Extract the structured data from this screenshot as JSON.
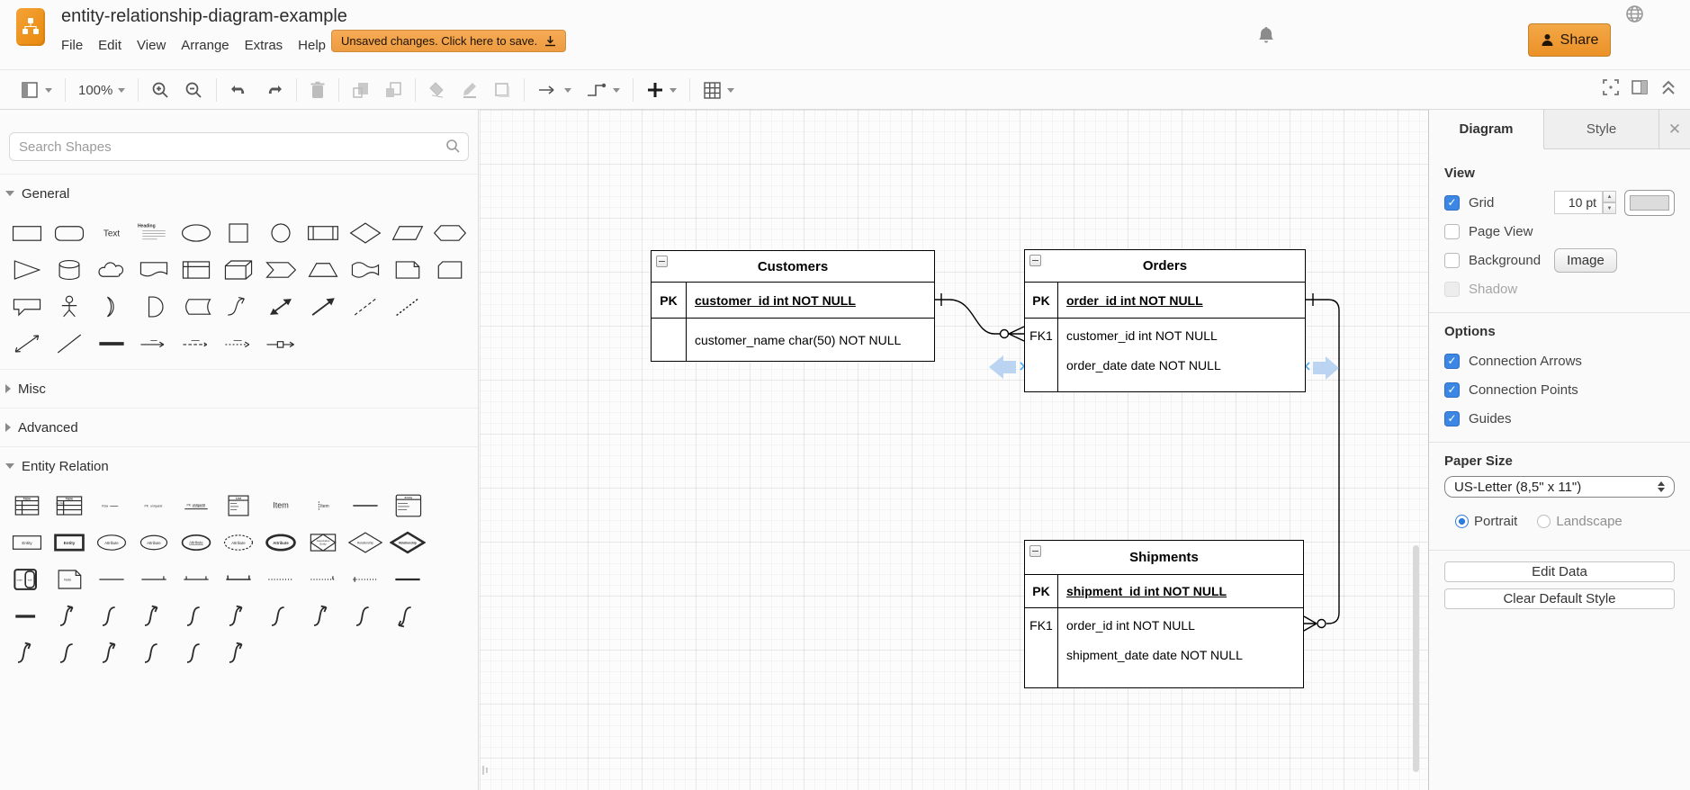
{
  "header": {
    "title": "entity-relationship-diagram-example",
    "menus": [
      "File",
      "Edit",
      "View",
      "Arrange",
      "Extras",
      "Help"
    ],
    "unsaved_banner": "Unsaved changes. Click here to save.",
    "share_label": "Share"
  },
  "toolbar": {
    "zoom_level": "100%"
  },
  "sidebar": {
    "search_placeholder": "Search Shapes",
    "sections": {
      "general": "General",
      "misc": "Misc",
      "advanced": "Advanced",
      "entity_relation": "Entity Relation"
    },
    "palettes": {
      "general": [
        [
          "rectangle",
          "rounded-rectangle",
          {
            "n": "text",
            "l": "Text"
          },
          {
            "n": "textbox",
            "l": "Heading"
          },
          "ellipse",
          "square",
          "circle",
          "process",
          "diamond",
          "parallelogram",
          "hexagon"
        ],
        [
          "triangle",
          "cylinder",
          "cloud",
          "document",
          "internal-storage",
          "cube",
          "step",
          "trapezoid",
          "tape",
          "note",
          "card"
        ],
        [
          "callout",
          "actor",
          "or",
          "and",
          "data-storage",
          "curve",
          "bidirectional-arrow",
          "arrow",
          "dashed-line",
          "dotted-line"
        ],
        [
          "bidirectional-connector",
          "line",
          "bold-line",
          "link-edge",
          "dashed-edge",
          "dashed-edge-2",
          "connector-symbol"
        ]
      ],
      "entity_relation": [
        [
          {
            "n": "table",
            "l": "Table"
          },
          {
            "n": "table-pk",
            "l": "Table"
          },
          "row",
          {
            "n": "row-pk",
            "l": "PK"
          },
          {
            "n": "row-pk-underlined",
            "l": "PK"
          },
          {
            "n": "list",
            "l": "List"
          },
          {
            "n": "item-large",
            "l": "Item"
          },
          {
            "n": "item",
            "l": "Item"
          },
          "hline",
          {
            "n": "entity-attributes",
            "l": "Entity"
          }
        ],
        [
          {
            "n": "entity",
            "l": "Entity"
          },
          {
            "n": "entity-bold",
            "l": "Entity"
          },
          {
            "n": "attribute",
            "l": "Attribute"
          },
          {
            "n": "attribute-2",
            "l": "Attribute"
          },
          {
            "n": "attribute-underlined",
            "l": "Attribute"
          },
          {
            "n": "attribute-dashed",
            "l": "Attribute"
          },
          {
            "n": "attribute-bold",
            "l": "Attribute"
          },
          {
            "n": "associative-entity",
            "l": "Entity"
          },
          {
            "n": "relationship",
            "l": "Relationship"
          },
          {
            "n": "relationship-bold",
            "l": "Relationship"
          }
        ],
        [
          "composite",
          {
            "n": "note-er",
            "l": "Note"
          },
          "link",
          "link-tick",
          "link-tick-2",
          "link-bracket",
          "link-dotted",
          "link-dotted-2",
          "link-dotted-3",
          "link-bold"
        ],
        [
          "edge-bold",
          "scurve-arrow",
          "scurve",
          "scurve-arrow",
          "scurve",
          "scurve-arrow",
          "scurve",
          "scurve-arrow",
          "scurve",
          "scurve-arrow-down"
        ],
        [
          "scurve-arrow",
          "scurve",
          "scurve-arrow",
          "scurve",
          "scurve",
          "scurve-arrow"
        ]
      ]
    }
  },
  "canvas": {
    "entities": [
      {
        "title": "Customers",
        "rows": [
          {
            "key": "PK",
            "text": "customer_id int NOT NULL"
          },
          {
            "key": "",
            "text": "customer_name char(50) NOT NULL"
          }
        ]
      },
      {
        "title": "Orders",
        "rows": [
          {
            "key": "PK",
            "text": "order_id int NOT NULL"
          },
          {
            "key": "FK1",
            "text": "customer_id int NOT NULL"
          },
          {
            "key": "",
            "text": "order_date date NOT NULL"
          }
        ]
      },
      {
        "title": "Shipments",
        "rows": [
          {
            "key": "PK",
            "text": "shipment_id int NOT NULL"
          },
          {
            "key": "FK1",
            "text": "order_id int NOT NULL"
          },
          {
            "key": "",
            "text": "shipment_date date NOT NULL"
          }
        ]
      }
    ],
    "connections": [
      {
        "from": "Customers.customer_id",
        "to": "Orders.customer_id",
        "from_end": "one",
        "to_end": "zero-or-many"
      },
      {
        "from": "Orders.order_id",
        "to": "Shipments.order_id",
        "from_end": "one",
        "to_end": "zero-or-many"
      }
    ]
  },
  "panel": {
    "tabs": [
      {
        "label": "Diagram",
        "active": true
      },
      {
        "label": "Style",
        "active": false
      }
    ],
    "view": {
      "heading": "View",
      "grid_label": "Grid",
      "grid_checked": true,
      "grid_size": "10 pt",
      "page_view_label": "Page View",
      "page_view_checked": false,
      "background_label": "Background",
      "background_checked": false,
      "image_button": "Image",
      "shadow_label": "Shadow",
      "shadow_checked": false,
      "shadow_disabled": true
    },
    "options": {
      "heading": "Options",
      "items": [
        {
          "label": "Connection Arrows",
          "checked": true
        },
        {
          "label": "Connection Points",
          "checked": true
        },
        {
          "label": "Guides",
          "checked": true
        }
      ]
    },
    "paper": {
      "heading": "Paper Size",
      "value": "US-Letter (8,5\" x 11\")",
      "portrait_label": "Portrait",
      "landscape_label": "Landscape",
      "orientation": "Portrait"
    },
    "edit_data_button": "Edit Data",
    "clear_default_style_button": "Clear Default Style",
    "accent_color": "#3d87e4"
  },
  "colors": {
    "brand_orange": "#ed9c41",
    "canvas_grid": "#e9e9e9",
    "hover_arrow_blue": "#aecdee"
  }
}
